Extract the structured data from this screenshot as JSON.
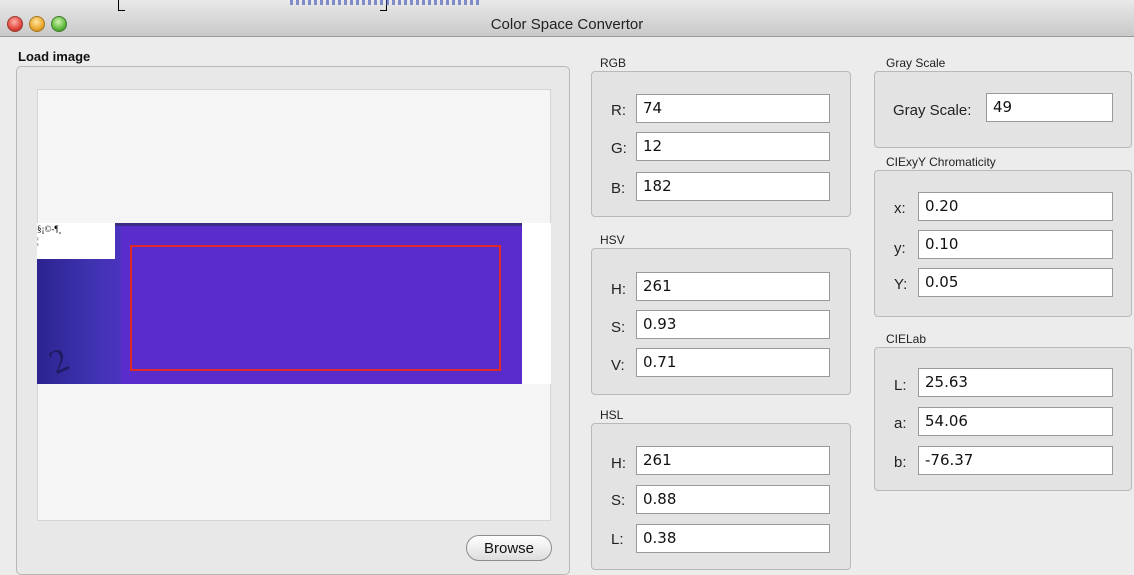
{
  "window": {
    "title": "Color Space Convertor"
  },
  "load": {
    "label": "Load image",
    "browse_label": "Browse",
    "stub_line1": "§¡©-¶¸",
    "stub_line2": "¦"
  },
  "rgb": {
    "label": "RGB",
    "rows": [
      {
        "label": "R:",
        "value": "74"
      },
      {
        "label": "G:",
        "value": "12"
      },
      {
        "label": "B:",
        "value": "182"
      }
    ]
  },
  "hsv": {
    "label": "HSV",
    "rows": [
      {
        "label": "H:",
        "value": "261"
      },
      {
        "label": "S:",
        "value": "0.93"
      },
      {
        "label": "V:",
        "value": "0.71"
      }
    ]
  },
  "hsl": {
    "label": "HSL",
    "rows": [
      {
        "label": "H:",
        "value": "261"
      },
      {
        "label": "S:",
        "value": "0.88"
      },
      {
        "label": "L:",
        "value": "0.38"
      }
    ]
  },
  "gray": {
    "label": "Gray Scale",
    "row_label": "Gray Scale:",
    "value": "49"
  },
  "ciexyy": {
    "label": "CIExyY Chromaticity",
    "rows": [
      {
        "label": "x:",
        "value": "0.20"
      },
      {
        "label": "y:",
        "value": "0.10"
      },
      {
        "label": "Y:",
        "value": "0.05"
      }
    ]
  },
  "cielab": {
    "label": "CIELab",
    "rows": [
      {
        "label": "L:",
        "value": "25.63"
      },
      {
        "label": "a:",
        "value": "54.06"
      },
      {
        "label": "b:",
        "value": "-76.37"
      }
    ]
  },
  "colors": {
    "sample": "#5a2ccc",
    "roi": "#e02a2a"
  }
}
